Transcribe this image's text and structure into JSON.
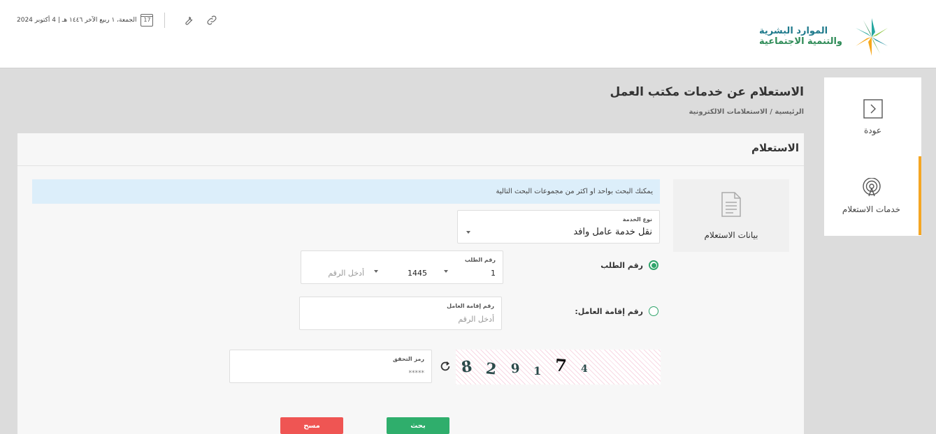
{
  "header": {
    "logo_line1": "الموارد البشرية",
    "logo_line2": "والتنمية الاجتماعية",
    "date_text": "الجمعة، ١ ربيع الآخر ١٤٤٦ هـ | 4 أكتوبر 2024",
    "calendar_day": "17"
  },
  "side_menu": {
    "back_label": "عودة",
    "services_label": "خدمات الاستعلام"
  },
  "page": {
    "title": "الاستعلام عن خدمات مكتب العمل",
    "breadcrumb": "الرئيسية / الاستعلامات الالكترونية"
  },
  "card": {
    "title": "الاستعلام",
    "tab_label": "بيانات الاستعلام",
    "info_text": "يمكنك البحث بواحد او اكثر من مجموعات البحث التالية",
    "service_type": {
      "label": "نوع الخدمة",
      "value": "نقل خدمة عامل وافد"
    },
    "request_option": {
      "label": "رقم الطلب"
    },
    "request_field": {
      "label": "رقم الطلب",
      "part1": "1",
      "part2": "1445",
      "placeholder": "أدخل الرقم"
    },
    "iqama_option": {
      "label": "رقم إقامة العامل:"
    },
    "iqama_field": {
      "label": "رقم إقامة العامل",
      "placeholder": "أدخل الرقم"
    },
    "captcha": {
      "digits": [
        "8",
        "2",
        "9",
        "1",
        "7",
        "4"
      ],
      "field_label": "رمز التحقق",
      "field_placeholder": "*****"
    },
    "search_button": "بحث",
    "clear_button": "مسح"
  },
  "colors": {
    "primary_green": "#2fae6c",
    "danger_red": "#ef5553",
    "accent_orange": "#f5a623",
    "info_bg": "#dceefa"
  }
}
